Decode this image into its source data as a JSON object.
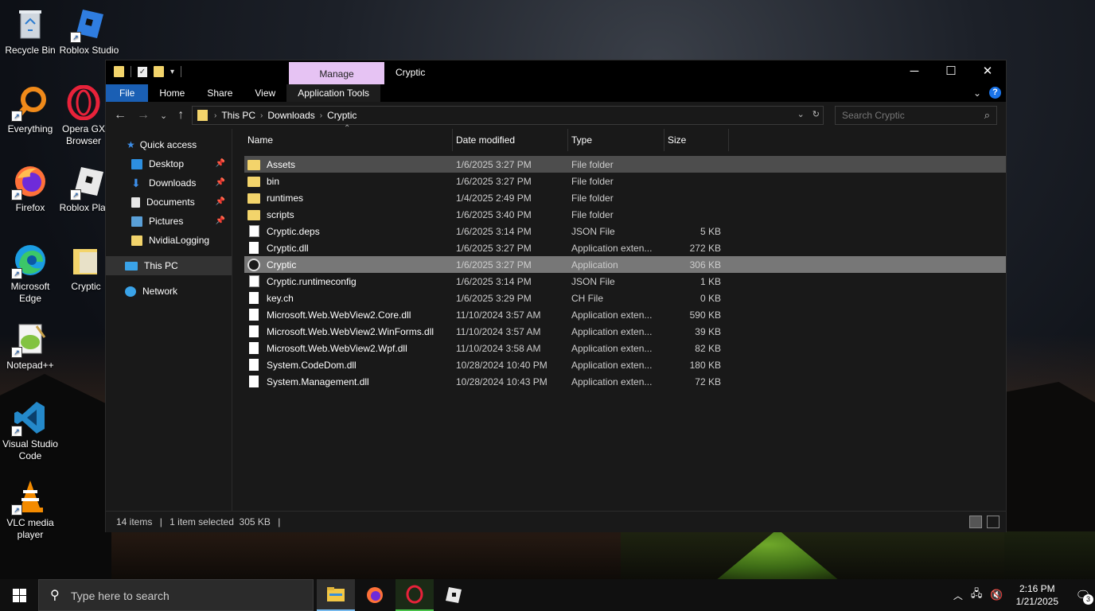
{
  "desktop": {
    "icons": [
      {
        "label": "Recycle Bin"
      },
      {
        "label": "Roblox Studio"
      },
      {
        "label": "Everything"
      },
      {
        "label": "Opera GX Browser"
      },
      {
        "label": "Firefox"
      },
      {
        "label": "Roblox Player"
      },
      {
        "label": "Microsoft Edge"
      },
      {
        "label": "Cryptic"
      },
      {
        "label": "Notepad++"
      },
      {
        "label": "Visual Studio Code"
      },
      {
        "label": "VLC media player"
      }
    ]
  },
  "window": {
    "manage_label": "Manage",
    "title": "Cryptic",
    "controls": {
      "minimize": "─",
      "maximize": "☐",
      "close": "✕"
    },
    "ribbon_tabs": [
      "File",
      "Home",
      "Share",
      "View",
      "Application Tools"
    ],
    "nav": {
      "back": "←",
      "forward": "→",
      "recent": "⌄",
      "up": "↑"
    },
    "address": {
      "crumbs": [
        "This PC",
        "Downloads",
        "Cryptic"
      ],
      "sep": "›"
    },
    "search_placeholder": "Search Cryptic",
    "sidebar": {
      "quick_access": "Quick access",
      "items": [
        {
          "label": "Desktop",
          "pinned": true
        },
        {
          "label": "Downloads",
          "pinned": true
        },
        {
          "label": "Documents",
          "pinned": true
        },
        {
          "label": "Pictures",
          "pinned": true
        },
        {
          "label": "NvidiaLogging",
          "pinned": false
        }
      ],
      "this_pc": "This PC",
      "network": "Network"
    },
    "columns": {
      "name": "Name",
      "date": "Date modified",
      "type": "Type",
      "size": "Size"
    },
    "files": [
      {
        "name": "Assets",
        "date": "1/6/2025 3:27 PM",
        "type": "File folder",
        "size": "",
        "icon": "folder"
      },
      {
        "name": "bin",
        "date": "1/6/2025 3:27 PM",
        "type": "File folder",
        "size": "",
        "icon": "folder"
      },
      {
        "name": "runtimes",
        "date": "1/4/2025 2:49 PM",
        "type": "File folder",
        "size": "",
        "icon": "folder"
      },
      {
        "name": "scripts",
        "date": "1/6/2025 3:40 PM",
        "type": "File folder",
        "size": "",
        "icon": "folder"
      },
      {
        "name": "Cryptic.deps",
        "date": "1/6/2025 3:14 PM",
        "type": "JSON File",
        "size": "5 KB",
        "icon": "json"
      },
      {
        "name": "Cryptic.dll",
        "date": "1/6/2025 3:27 PM",
        "type": "Application exten...",
        "size": "272 KB",
        "icon": "doc"
      },
      {
        "name": "Cryptic",
        "date": "1/6/2025 3:27 PM",
        "type": "Application",
        "size": "306 KB",
        "icon": "app"
      },
      {
        "name": "Cryptic.runtimeconfig",
        "date": "1/6/2025 3:14 PM",
        "type": "JSON File",
        "size": "1 KB",
        "icon": "json"
      },
      {
        "name": "key.ch",
        "date": "1/6/2025 3:29 PM",
        "type": "CH File",
        "size": "0 KB",
        "icon": "doc"
      },
      {
        "name": "Microsoft.Web.WebView2.Core.dll",
        "date": "11/10/2024 3:57 AM",
        "type": "Application exten...",
        "size": "590 KB",
        "icon": "doc"
      },
      {
        "name": "Microsoft.Web.WebView2.WinForms.dll",
        "date": "11/10/2024 3:57 AM",
        "type": "Application exten...",
        "size": "39 KB",
        "icon": "doc"
      },
      {
        "name": "Microsoft.Web.WebView2.Wpf.dll",
        "date": "11/10/2024 3:58 AM",
        "type": "Application exten...",
        "size": "82 KB",
        "icon": "doc"
      },
      {
        "name": "System.CodeDom.dll",
        "date": "10/28/2024 10:40 PM",
        "type": "Application exten...",
        "size": "180 KB",
        "icon": "doc"
      },
      {
        "name": "System.Management.dll",
        "date": "10/28/2024 10:43 PM",
        "type": "Application exten...",
        "size": "72 KB",
        "icon": "doc"
      }
    ],
    "status": {
      "count": "14 items",
      "selection": "1 item selected  305 KB",
      "sep": "|"
    }
  },
  "taskbar": {
    "search_placeholder": "Type here to search",
    "time": "2:16 PM",
    "date": "1/21/2025",
    "notification_count": "3"
  },
  "colors": {
    "file_tab": "#1a5fb4",
    "manage_tab": "#e6c3f3",
    "folder": "#f3d46b"
  }
}
